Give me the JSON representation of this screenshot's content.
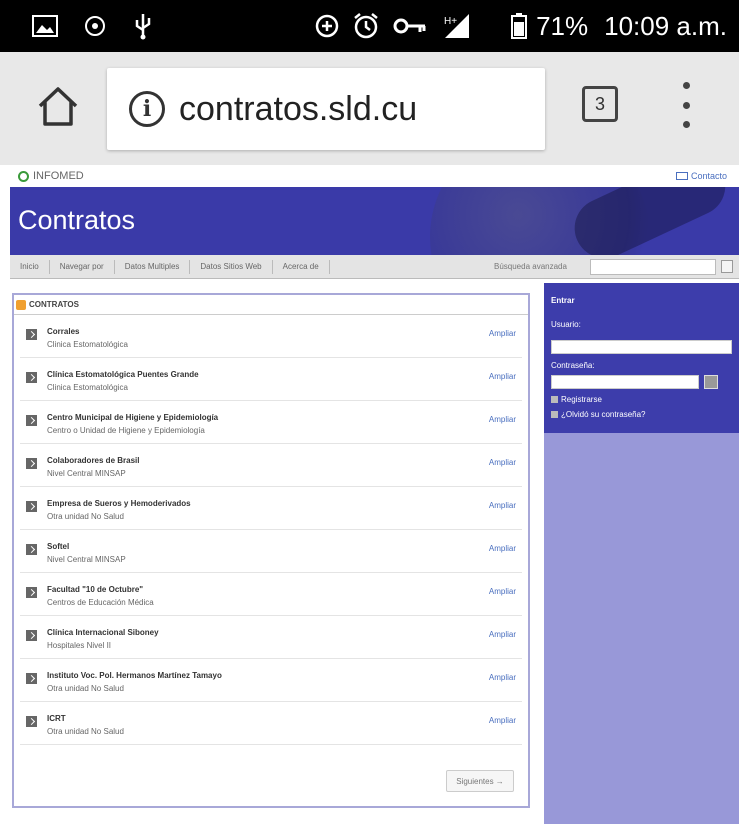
{
  "status_bar": {
    "battery": "71%",
    "time": "10:09 a.m.",
    "network": "H+"
  },
  "browser": {
    "url": "contratos.sld.cu",
    "tab_count": "3"
  },
  "site": {
    "logo_text": "INFOMED",
    "contact_link": "Contacto",
    "banner_title": "Contratos",
    "nav_items": [
      "Inicio",
      "Navegar por",
      "Datos Multiples",
      "Datos Sitios Web",
      "Acerca de"
    ],
    "search_label": "Búsqueda avanzada"
  },
  "content": {
    "header": "CONTRATOS",
    "link_label": "Ampliar",
    "items": [
      {
        "title": "Corrales",
        "subtitle": "Clinica Estomatológica"
      },
      {
        "title": "Clínica Estomatológica Puentes Grande",
        "subtitle": "Clinica Estomatológica"
      },
      {
        "title": "Centro Municipal de Higiene y Epidemiología",
        "subtitle": "Centro o Unidad de Higiene y Epidemiología"
      },
      {
        "title": "Colaboradores de Brasil",
        "subtitle": "Nivel Central MINSAP"
      },
      {
        "title": "Empresa de Sueros y Hemoderivados",
        "subtitle": "Otra unidad No Salud"
      },
      {
        "title": "Softel",
        "subtitle": "Nivel Central MINSAP"
      },
      {
        "title": "Facultad \"10 de Octubre\"",
        "subtitle": "Centros de Educación Médica"
      },
      {
        "title": "Clínica Internacional Siboney",
        "subtitle": "Hospitales Nivel II"
      },
      {
        "title": "Instituto Voc. Pol. Hermanos Martínez Tamayo",
        "subtitle": "Otra unidad No Salud"
      },
      {
        "title": "ICRT",
        "subtitle": "Otra unidad No Salud"
      }
    ],
    "next_button": "Siguientes →"
  },
  "sidebar": {
    "heading": "Entrar",
    "user_label": "Usuario:",
    "password_label": "Contraseña:",
    "register_link": "Registrarse",
    "forgot_link": "¿Olvidó su contraseña?"
  },
  "colors": {
    "banner": "#3a3aa8",
    "sidebar": "#9898d8",
    "sidebar_top": "#3d3dab",
    "link": "#4a6fbf"
  }
}
